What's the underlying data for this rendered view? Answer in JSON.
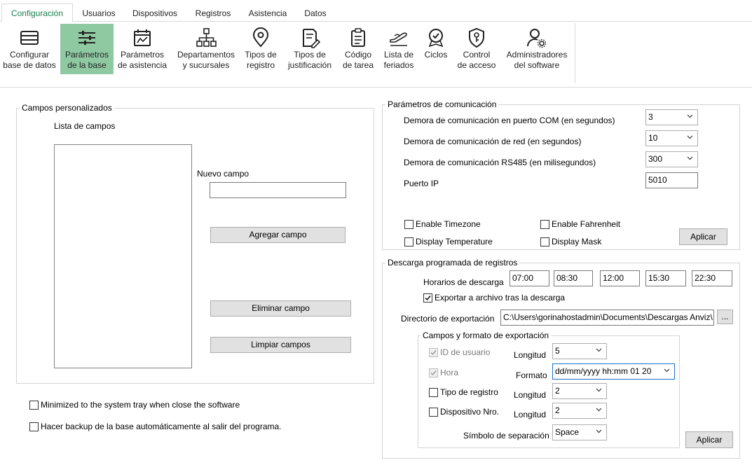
{
  "tabs": [
    "Configuración",
    "Usuarios",
    "Dispositivos",
    "Registros",
    "Asistencia",
    "Datos"
  ],
  "ribbon": [
    {
      "label": "Configurar\nbase de datos",
      "icon": "database-icon"
    },
    {
      "label": "Parámetros\nde la base",
      "icon": "sliders-icon"
    },
    {
      "label": "Parámetros\nde asistencia",
      "icon": "calendar-chart-icon"
    },
    {
      "label": "Departamentos\ny sucursales",
      "icon": "org-chart-icon"
    },
    {
      "label": "Tipos de\nregistro",
      "icon": "location-pin-icon"
    },
    {
      "label": "Tipos de\njustificación",
      "icon": "document-edit-icon"
    },
    {
      "label": "Código\nde tarea",
      "icon": "clipboard-icon"
    },
    {
      "label": "Lista de\nferiados",
      "icon": "airplane-icon"
    },
    {
      "label": "Ciclos",
      "icon": "badge-check-icon"
    },
    {
      "label": "Control\nde acceso",
      "icon": "key-shield-icon"
    },
    {
      "label": "Administradores\ndel software",
      "icon": "user-gear-icon"
    }
  ],
  "custom_fields": {
    "title": "Campos personalizados",
    "list_label": "Lista de campos",
    "new_field_label": "Nuevo campo",
    "new_field_value": "",
    "add_button": "Agregar campo",
    "delete_button": "Eliminar campo",
    "clear_button": "Limpiar campos"
  },
  "options": {
    "minimize_tray": "Minimized to the system tray when close the software",
    "auto_backup": "Hacer backup de la base automáticamente al salir del programa."
  },
  "comm": {
    "title": "Parámetros de comunicación",
    "com_delay_label": "Demora de comunicación en puerto COM (en segundos)",
    "com_delay_value": "3",
    "net_delay_label": "Demora de comunicación de red (en segundos)",
    "net_delay_value": "10",
    "rs485_delay_label": "Demora de comunicación RS485 (en milisegundos)",
    "rs485_delay_value": "300",
    "ip_port_label": "Puerto IP",
    "ip_port_value": "5010",
    "enable_timezone": "Enable Timezone",
    "enable_fahrenheit": "Enable Fahrenheit",
    "display_temperature": "Display Temperature",
    "display_mask": "Display Mask",
    "apply_button": "Aplicar"
  },
  "download": {
    "title": "Descarga programada de registros",
    "times_label": "Horarios de descarga",
    "times": [
      "07:00",
      "08:30",
      "12:00",
      "15:30",
      "22:30"
    ],
    "export_label": "Exportar a archivo tras la descarga",
    "export_checked": true,
    "dir_label": "Directorio de exportación",
    "dir_value": "C:\\Users\\gorinahostadmin\\Documents\\Descargas Anviz\\",
    "browse_button": "...",
    "format_group": {
      "title": "Campos y formato de exportación",
      "user_id_label": "ID de usuario",
      "time_label": "Hora",
      "record_type_label": "Tipo de registro",
      "device_no_label": "Dispositivo Nro.",
      "length_label": "Longitud",
      "format_label": "Formato",
      "user_id_length": "5",
      "format_value": "dd/mm/yyyy hh:mm 01 20",
      "record_type_length": "2",
      "device_no_length": "2",
      "separator_label": "Símbolo de separación",
      "separator_value": "Space"
    },
    "apply_button": "Aplicar"
  }
}
